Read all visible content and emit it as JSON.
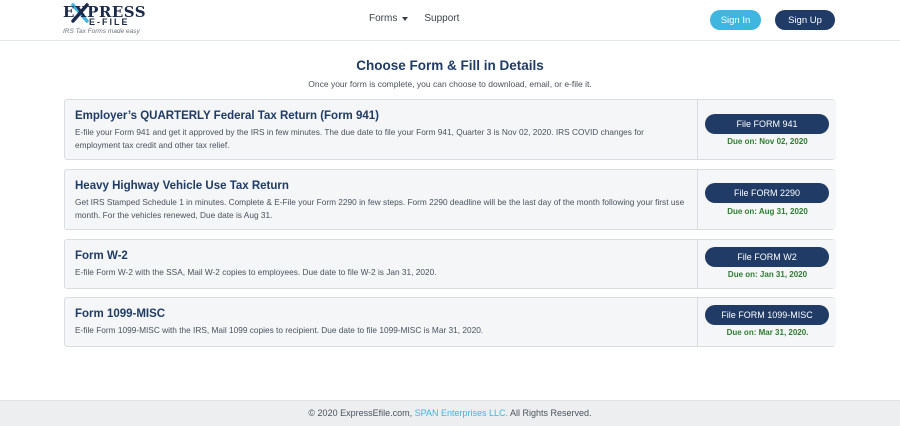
{
  "header": {
    "logo_text": "EXPRESS",
    "logo_sub": "E-FILE",
    "logo_tagline": "IRS Tax Forms made easy",
    "nav": [
      {
        "label": "Forms",
        "icon": "caret-down-icon"
      },
      {
        "label": "Support"
      }
    ],
    "signin_label": "Sign In",
    "signup_label": "Sign Up"
  },
  "main": {
    "title": "Choose Form & Fill in Details",
    "subtitle": "Once your form is complete, you can choose to download, email, or e-file it.",
    "forms": [
      {
        "title": "Employer’s QUARTERLY Federal Tax Return (Form 941)",
        "description": "E-file your Form 941 and get it approved by the IRS in few minutes. The due date to file your Form 941, Quarter 3 is Nov 02, 2020. IRS COVID changes for employment tax credit and other tax relief.",
        "button": "File FORM 941",
        "due": "Due on: Nov 02, 2020"
      },
      {
        "title": "Heavy Highway Vehicle Use Tax Return",
        "description": "Get IRS Stamped Schedule 1 in minutes. Complete & E-File your Form 2290 in few steps. Form 2290 deadline will be the last day of the month following your first use month. For the vehicles renewed, Due date is Aug 31.",
        "button": "File FORM 2290",
        "due": "Due on: Aug 31, 2020"
      },
      {
        "title": "Form W-2",
        "description": "E-file Form W-2 with the SSA, Mail W-2 copies to employees. Due date to file W-2 is Jan 31, 2020.",
        "button": "File FORM W2",
        "due": "Due on: Jan 31, 2020"
      },
      {
        "title": "Form 1099-MISC",
        "description": "E-file Form 1099-MISC with the IRS, Mail 1099 copies to recipient. Due date to file 1099-MISC is Mar 31, 2020.",
        "button": "File FORM 1099-MISC",
        "due": "Due on: Mar 31, 2020."
      }
    ]
  },
  "footer": {
    "prefix": "© 2020 ExpressEfile.com,",
    "link": "SPAN Enterprises LLC.",
    "suffix": "All Rights Reserved."
  },
  "colors": {
    "brand_navy": "#1f3b66",
    "accent_blue": "#3fb6e0",
    "due_green": "#2e7d32"
  }
}
